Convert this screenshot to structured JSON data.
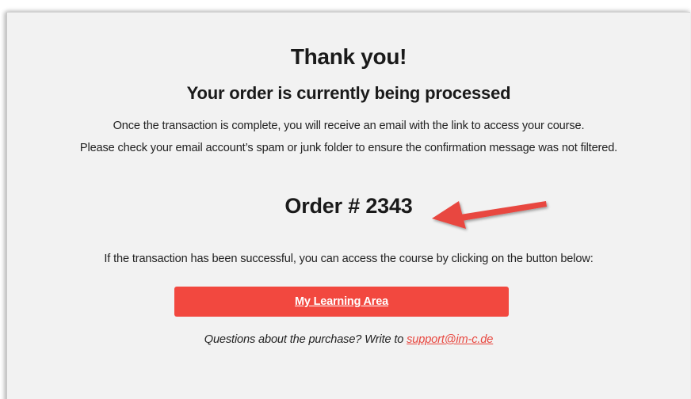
{
  "confirmation": {
    "title": "Thank you!",
    "subtitle": "Your order is currently being processed",
    "message_line_1": "Once the transaction is complete, you will receive an email with the link to access your course.",
    "message_line_2": "Please check your email account’s spam or junk folder to ensure the confirmation message was not filtered.",
    "order_number": "Order # 2343",
    "instructions": "If the transaction has been successful, you can access the course by clicking on the button below:",
    "button_label": "My Learning Area",
    "questions_prefix": "Questions about the purchase? Write to ",
    "support_email": "support@im-c.de"
  },
  "annotation": {
    "arrow_icon": "arrow-left-icon",
    "arrow_color": "#e8473f"
  },
  "colors": {
    "accent": "#f2483f",
    "background": "#f2f2f2",
    "text": "#1a1a1a"
  }
}
